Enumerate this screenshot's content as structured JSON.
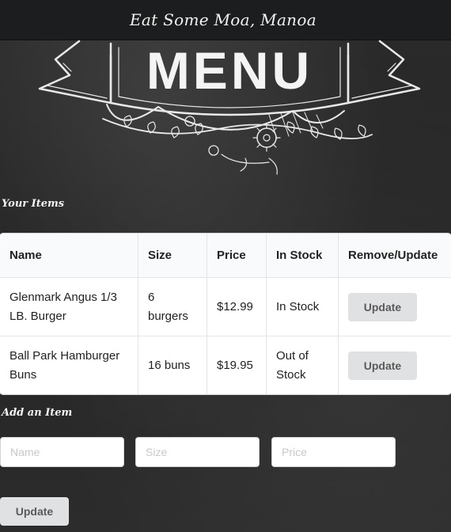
{
  "header": {
    "brand": "Eat Some Moa, Manoa"
  },
  "banner": {
    "text": "MENU"
  },
  "your_items": {
    "heading": "Your Items",
    "columns": [
      "Name",
      "Size",
      "Price",
      "In Stock",
      "Remove/Update"
    ],
    "rows": [
      {
        "name": "Glenmark Angus 1/3 LB. Burger",
        "size": "6 burgers",
        "price": "$12.99",
        "stock": "In Stock",
        "action": "Update"
      },
      {
        "name": "Ball Park Hamburger Buns",
        "size": "16 buns",
        "price": "$19.95",
        "stock": "Out of Stock",
        "action": "Update"
      }
    ]
  },
  "add_item": {
    "heading": "Add an Item",
    "name_placeholder": "Name",
    "size_placeholder": "Size",
    "price_placeholder": "Price",
    "submit_label": "Update"
  }
}
